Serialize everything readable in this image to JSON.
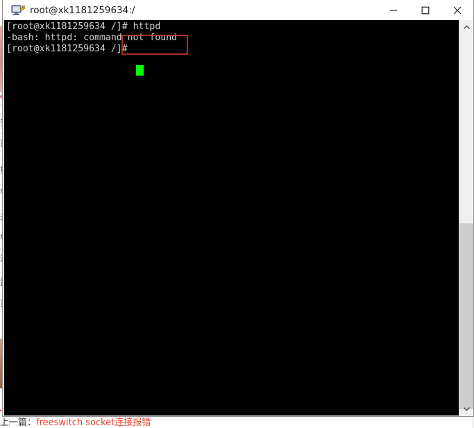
{
  "window": {
    "title": "root@xk1181259634:/",
    "icon": "putty-terminal-icon",
    "controls": {
      "minimize_label": "Minimize",
      "maximize_label": "Maximize",
      "close_label": "Close"
    }
  },
  "terminal": {
    "background_color": "#000000",
    "text_color": "#d4d4d4",
    "cursor_color": "#00ff00",
    "lines": [
      "[root@xk1181259634 /]# httpd",
      "-bash: httpd: command not found",
      "[root@xk1181259634 /]# "
    ],
    "prompt": "[root@xk1181259634 /]#",
    "command": "httpd",
    "error": "-bash: httpd: command not found"
  },
  "annotation": {
    "name": "red-highlight-box",
    "color": "#c0392b",
    "targets": "httpd"
  },
  "scrollbar": {
    "up_arrow": "▲",
    "down_arrow": "▼",
    "thumb_color": "#cdcdcd",
    "track_color": "#f0f0f0"
  },
  "background_page": {
    "red_fragment": "e",
    "side_items": [
      "安",
      "而",
      "重",
      "rs",
      "关",
      "rs",
      "测",
      "置",
      "览"
    ],
    "footer": {
      "label": "上一篇：",
      "link": "freeswitch socket连接报错"
    }
  }
}
